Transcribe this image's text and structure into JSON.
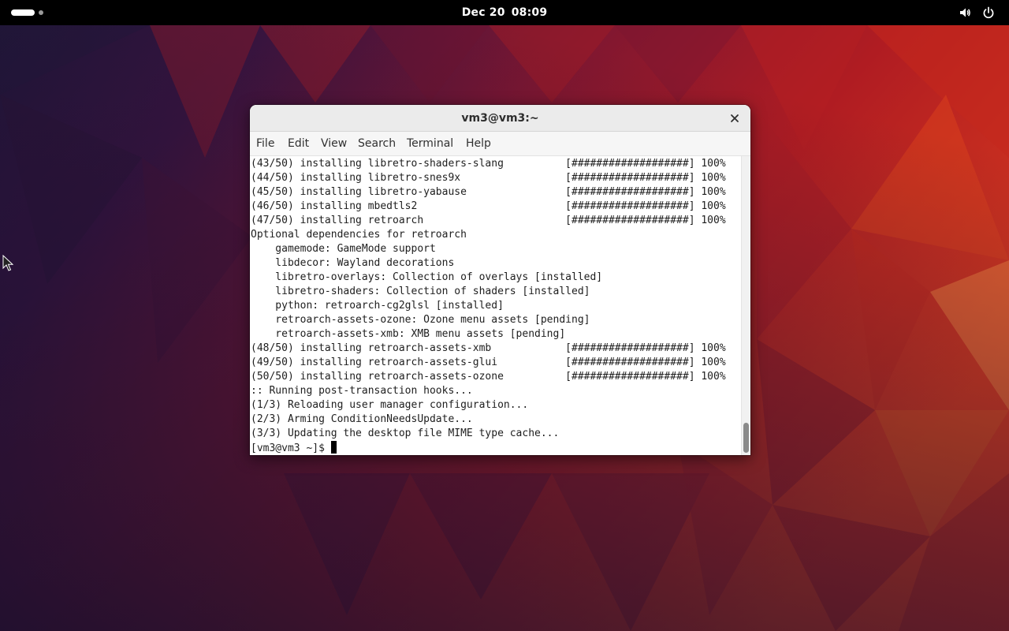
{
  "topbar": {
    "date": "Dec 20",
    "time": "08:09",
    "icons": {
      "workspaces": "workspace-indicator-icon",
      "volume": "volume-icon",
      "power": "power-icon"
    }
  },
  "window": {
    "title": "vm3@vm3:~",
    "close_icon": "close-icon"
  },
  "menu": [
    {
      "label": "File"
    },
    {
      "label": "Edit"
    },
    {
      "label": "View"
    },
    {
      "label": "Search"
    },
    {
      "label": "Terminal"
    },
    {
      "label": "Help"
    }
  ],
  "terminal": {
    "lines": [
      "(43/50) installing libretro-shaders-slang          [###################] 100%",
      "(44/50) installing libretro-snes9x                 [###################] 100%",
      "(45/50) installing libretro-yabause                [###################] 100%",
      "(46/50) installing mbedtls2                        [###################] 100%",
      "(47/50) installing retroarch                       [###################] 100%",
      "Optional dependencies for retroarch",
      "    gamemode: GameMode support",
      "    libdecor: Wayland decorations",
      "    libretro-overlays: Collection of overlays [installed]",
      "    libretro-shaders: Collection of shaders [installed]",
      "    python: retroarch-cg2glsl [installed]",
      "    retroarch-assets-ozone: Ozone menu assets [pending]",
      "    retroarch-assets-xmb: XMB menu assets [pending]",
      "(48/50) installing retroarch-assets-xmb            [###################] 100%",
      "(49/50) installing retroarch-assets-glui           [###################] 100%",
      "(50/50) installing retroarch-assets-ozone          [###################] 100%",
      ":: Running post-transaction hooks...",
      "(1/3) Reloading user manager configuration...",
      "(2/3) Arming ConditionNeedsUpdate...",
      "(3/3) Updating the desktop file MIME type cache..."
    ],
    "prompt": "[vm3@vm3 ~]$ "
  },
  "colors": {
    "topbar": "#000000",
    "titlebar": "#ebebeb",
    "terminal_bg": "#ffffff",
    "terminal_fg": "#1e1e1e",
    "wallpaper_dark": "#2a1030",
    "wallpaper_red": "#b3201f",
    "wallpaper_orange": "#e85a20"
  }
}
